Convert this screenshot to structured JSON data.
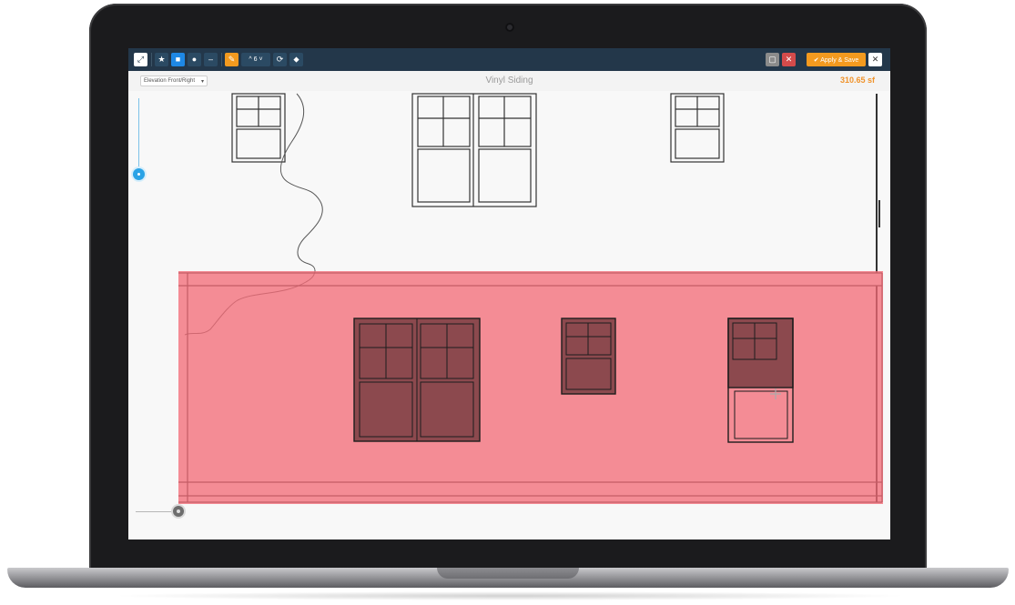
{
  "toolbar": {
    "apply_label": "✔ Apply & Save",
    "close_label": "✕",
    "pitch_label": "^ 6 ˅",
    "tools": [
      "move-tool",
      "measure-tool",
      "area-tool",
      "point-tool",
      "line-tool",
      "paint-tool",
      "rotate-tool",
      "tag-tool"
    ]
  },
  "header": {
    "elevation_select": "Elevation Front/Right",
    "title": "Vinyl Siding",
    "measurement": "310.65 sf"
  },
  "colors": {
    "toolbar_bg": "#23374a",
    "accent_blue": "#1e88e5",
    "accent_orange": "#f39a1f",
    "selection_fill": "#f26d78",
    "measurement_text": "#f0932b"
  },
  "icons": {
    "zoom_slider": "zoom-slider-icon",
    "pan_handle": "pan-handle-icon"
  }
}
